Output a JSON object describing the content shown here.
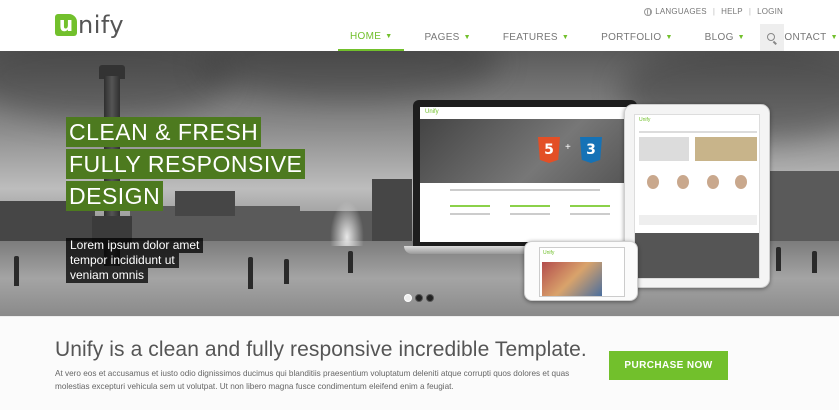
{
  "brand": {
    "logo_letter": "u",
    "logo_rest": "nify",
    "accent": "#72c02c"
  },
  "topbar": {
    "languages_icon": "globe-icon",
    "languages": "LANGUAGES",
    "help": "HELP",
    "login": "LOGIN"
  },
  "nav": {
    "items": [
      {
        "label": "HOME",
        "active": true
      },
      {
        "label": "PAGES"
      },
      {
        "label": "FEATURES"
      },
      {
        "label": "PORTFOLIO"
      },
      {
        "label": "BLOG"
      },
      {
        "label": "CONTACT"
      }
    ],
    "search_icon": "search-icon"
  },
  "slider": {
    "caption_lines": [
      "CLEAN & FRESH",
      "FULLY RESPONSIVE",
      "DESIGN"
    ],
    "subcaption_lines": [
      "Lorem ipsum dolor amet",
      "tempor incididunt ut",
      "veniam omnis"
    ],
    "slides_total": 3,
    "active_slide": 1,
    "caption_color": "#4d7a1f"
  },
  "mockup": {
    "laptop_logo": "Unify",
    "html5_label": "5",
    "css3_label": "3",
    "tablet_logo": "Unify",
    "phone_logo": "Unify"
  },
  "purchase": {
    "title": "Unify is a clean and fully responsive incredible Template.",
    "text": "At vero eos et accusamus et iusto odio dignissimos ducimus qui blanditiis praesentium voluptatum deleniti atque corrupti quos dolores et quas molestias excepturi vehicula sem ut volutpat. Ut non libero magna fusce condimentum eleifend enim a feugiat.",
    "button": "PURCHASE NOW"
  }
}
